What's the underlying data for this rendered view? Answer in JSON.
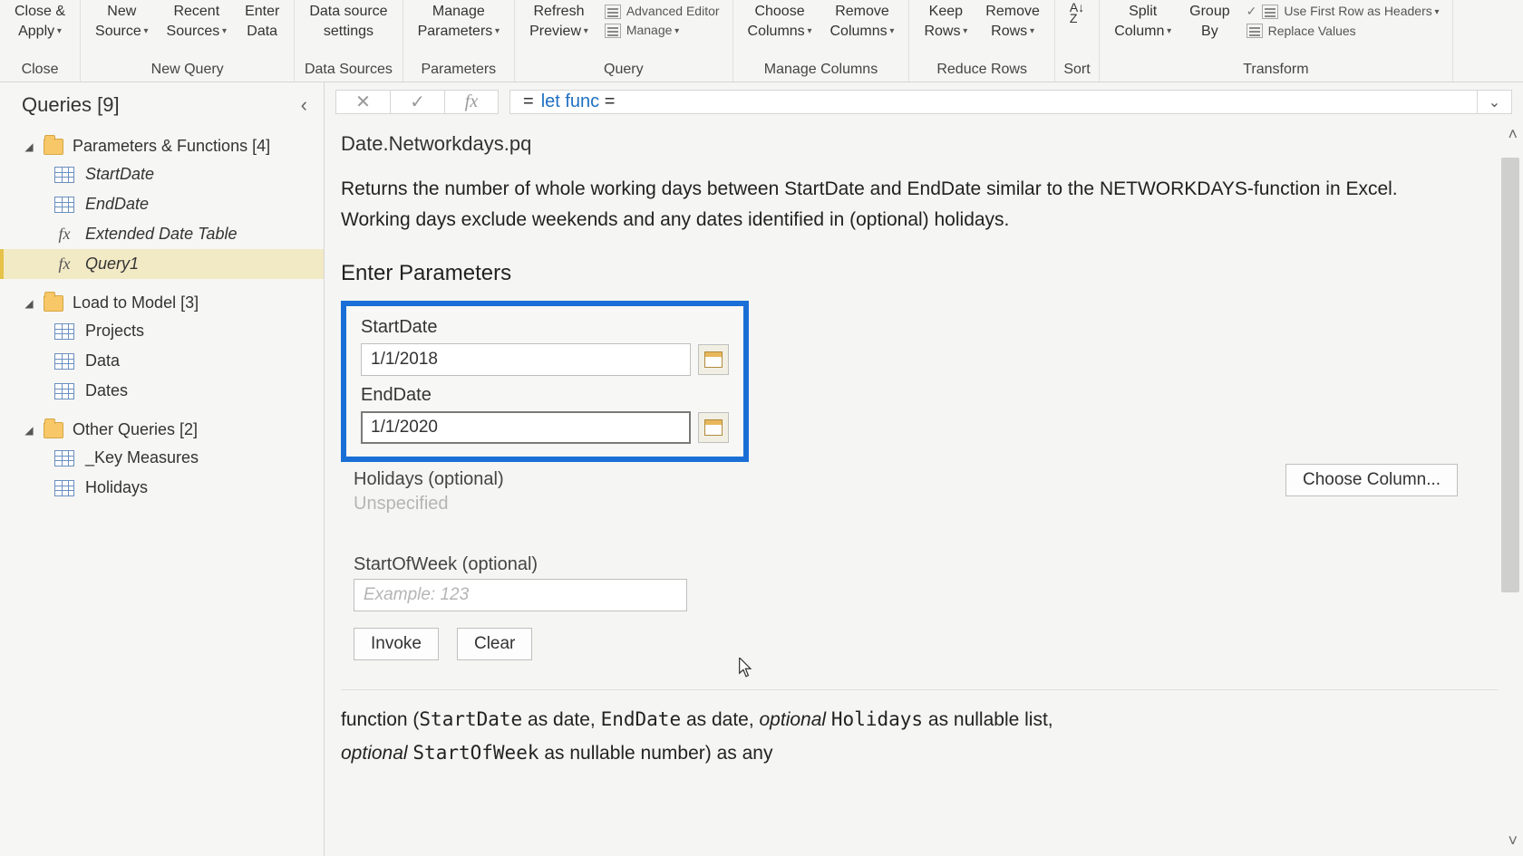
{
  "ribbon": {
    "groups": [
      {
        "label": "Close",
        "buttons": [
          {
            "top": "Close &",
            "bot": "Apply",
            "caret": true
          }
        ]
      },
      {
        "label": "New Query",
        "buttons": [
          {
            "top": "New",
            "bot": "Source",
            "caret": true
          },
          {
            "top": "Recent",
            "bot": "Sources",
            "caret": true
          },
          {
            "top": "Enter",
            "bot": "Data",
            "caret": false
          }
        ]
      },
      {
        "label": "Data Sources",
        "buttons": [
          {
            "top": "Data source",
            "bot": "settings",
            "caret": false
          }
        ]
      },
      {
        "label": "Parameters",
        "buttons": [
          {
            "top": "Manage",
            "bot": "Parameters",
            "caret": true
          }
        ]
      },
      {
        "label": "Query",
        "buttons": [
          {
            "top": "Refresh",
            "bot": "Preview",
            "caret": true
          }
        ],
        "stack": [
          {
            "label": "Advanced Editor"
          },
          {
            "label": "Manage",
            "caret": true
          }
        ]
      },
      {
        "label": "Manage Columns",
        "buttons": [
          {
            "top": "Choose",
            "bot": "Columns",
            "caret": true
          },
          {
            "top": "Remove",
            "bot": "Columns",
            "caret": true
          }
        ]
      },
      {
        "label": "Reduce Rows",
        "buttons": [
          {
            "top": "Keep",
            "bot": "Rows",
            "caret": true
          },
          {
            "top": "Remove",
            "bot": "Rows",
            "caret": true
          }
        ]
      },
      {
        "label": "Sort",
        "buttons": []
      },
      {
        "label": "Transform",
        "buttons": [
          {
            "top": "Split",
            "bot": "Column",
            "caret": true
          },
          {
            "top": "Group",
            "bot": "By",
            "caret": false
          }
        ],
        "stack2": [
          {
            "label": "Use First Row as Headers",
            "caret": true
          },
          {
            "label": "Replace Values"
          }
        ]
      }
    ]
  },
  "formula_bar": {
    "prefix": "=",
    "kw1": "let",
    "kw2": "func",
    "suffix": "="
  },
  "queries": {
    "title": "Queries [9]",
    "groups": [
      {
        "name": "Parameters & Functions [4]",
        "items": [
          {
            "icon": "table",
            "label": "StartDate",
            "italic": true
          },
          {
            "icon": "table",
            "label": "EndDate",
            "italic": true
          },
          {
            "icon": "fx",
            "label": "Extended Date Table",
            "italic": true
          },
          {
            "icon": "fx",
            "label": "Query1",
            "italic": true,
            "selected": true
          }
        ]
      },
      {
        "name": "Load to Model [3]",
        "items": [
          {
            "icon": "table",
            "label": "Projects"
          },
          {
            "icon": "table",
            "label": "Data"
          },
          {
            "icon": "table",
            "label": "Dates"
          }
        ]
      },
      {
        "name": "Other Queries [2]",
        "items": [
          {
            "icon": "table",
            "label": "_Key Measures"
          },
          {
            "icon": "table",
            "label": "Holidays"
          }
        ]
      }
    ]
  },
  "fn": {
    "title": "Date.Networkdays.pq",
    "desc": "Returns the number of whole working days between StartDate and EndDate similar to the NETWORKDAYS-function in Excel. Working days exclude weekends and any dates identified in (optional) holidays.",
    "enter_params": "Enter Parameters",
    "start": {
      "label": "StartDate",
      "value": "1/1/2018"
    },
    "end": {
      "label": "EndDate",
      "value": "1/1/2020"
    },
    "holidays": {
      "label": "Holidays (optional)",
      "value": "Unspecified",
      "choose": "Choose Column..."
    },
    "sow": {
      "label": "StartOfWeek (optional)",
      "placeholder": "Example: 123"
    },
    "invoke": "Invoke",
    "clear": "Clear",
    "sig": {
      "func": "function",
      "p1": "StartDate",
      "t1": " as date, ",
      "p2": "EndDate",
      "t2": " as date, ",
      "opt": "optional ",
      "p3": "Holidays",
      "t3": " as nullable list,",
      "p4": "StartOfWeek",
      "t4": " as nullable number) as any"
    }
  }
}
